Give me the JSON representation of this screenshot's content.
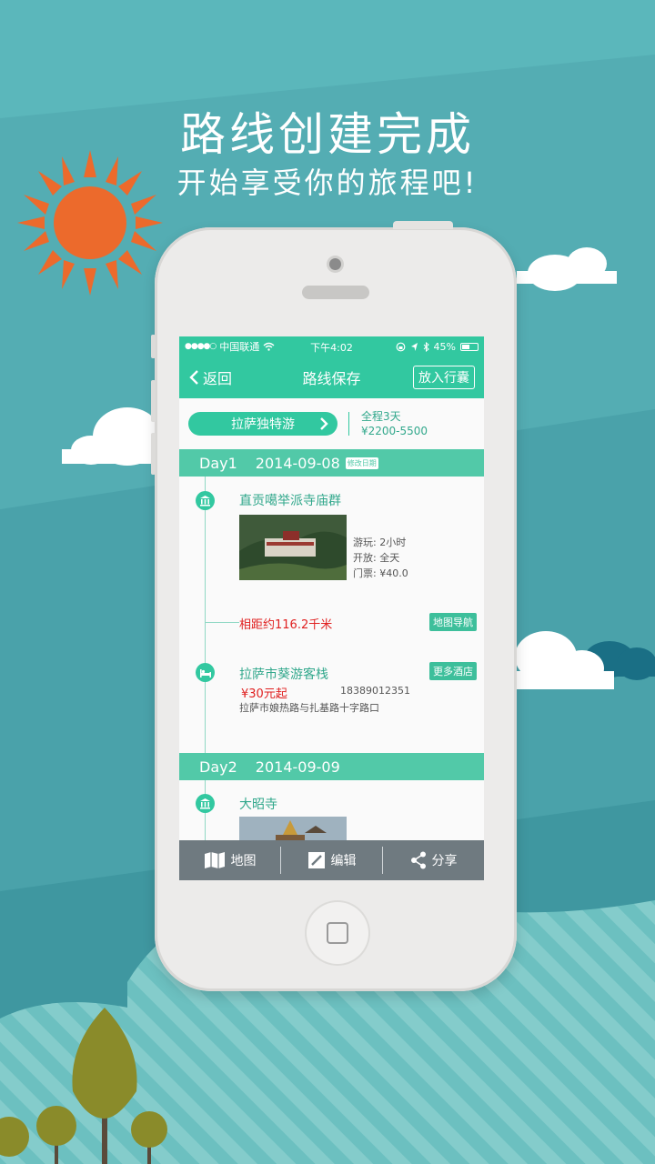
{
  "headline": {
    "line1": "路线创建完成",
    "line2": "开始享受你的旅程吧!"
  },
  "colors": {
    "accent": "#32c8a0",
    "background": "#5bb7bb",
    "price": "#e02020",
    "toolbar": "#6f7a80"
  },
  "statusbar": {
    "carrier": "中国联通",
    "time": "下午4:02",
    "battery": "45%"
  },
  "navbar": {
    "back_label": "返回",
    "title": "路线保存",
    "action_label": "放入行囊"
  },
  "route": {
    "name": "拉萨独特游",
    "duration": "全程3天",
    "budget": "¥2200-5500"
  },
  "days": [
    {
      "label": "Day1",
      "date": "2014-09-08",
      "edit_label": "修改日期",
      "poi": {
        "title": "直贡噶举派寺庙群",
        "play": "游玩: 2小时",
        "open": "开放: 全天",
        "ticket": "门票: ¥40.0"
      },
      "distance": "相距约116.2千米",
      "nav_label": "地图导航",
      "hotel": {
        "title": "拉萨市葵游客栈",
        "more_label": "更多酒店",
        "price": "¥30元起",
        "phone": "18389012351",
        "address": "拉萨市娘热路与扎基路十字路口"
      }
    },
    {
      "label": "Day2",
      "date": "2014-09-09",
      "poi": {
        "title": "大昭寺"
      }
    }
  ],
  "toolbar": {
    "map_label": "地图",
    "edit_label": "编辑",
    "share_label": "分享"
  }
}
